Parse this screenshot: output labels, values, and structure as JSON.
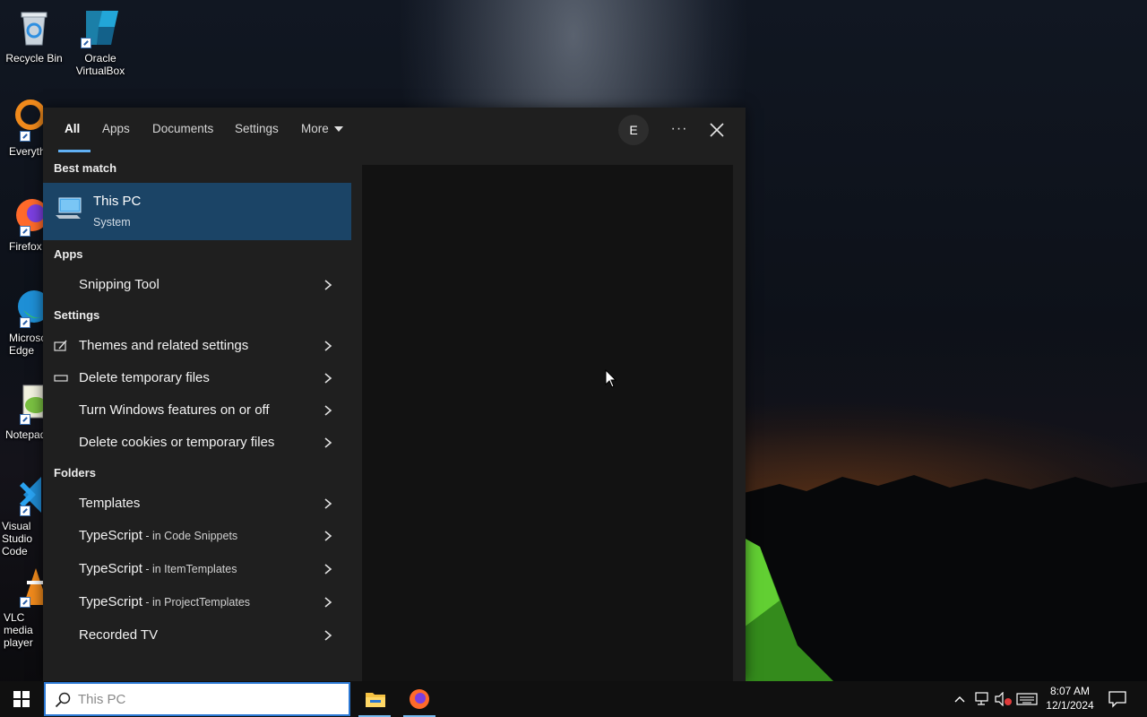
{
  "desktop": {
    "icons": [
      {
        "label": "Recycle Bin"
      },
      {
        "label": "Oracle VirtualBox"
      },
      {
        "label": "Everything"
      },
      {
        "label": "Firefox"
      },
      {
        "label": "Microsoft Edge"
      },
      {
        "label": "Notepad++"
      },
      {
        "label": "Visual Studio Code"
      },
      {
        "label": "VLC media player"
      }
    ]
  },
  "search": {
    "tabs": [
      {
        "label": "All"
      },
      {
        "label": "Apps"
      },
      {
        "label": "Documents"
      },
      {
        "label": "Settings"
      },
      {
        "label": "More"
      }
    ],
    "avatar_initial": "E",
    "more_options": "···",
    "sections": {
      "best_match": "Best match",
      "apps": "Apps",
      "settings": "Settings",
      "folders": "Folders"
    },
    "best_match": {
      "title": "This PC",
      "subtitle": "System"
    },
    "apps": [
      {
        "label": "Snipping Tool"
      }
    ],
    "settings": [
      {
        "label": "Themes and related settings"
      },
      {
        "label": "Delete temporary files"
      },
      {
        "label": "Turn Windows features on or off"
      },
      {
        "label": "Delete cookies or temporary files"
      }
    ],
    "folders": [
      {
        "label": "Templates",
        "sub": ""
      },
      {
        "label": "TypeScript",
        "sub": " - in Code Snippets"
      },
      {
        "label": "TypeScript",
        "sub": " - in ItemTemplates"
      },
      {
        "label": "TypeScript",
        "sub": " - in ProjectTemplates"
      },
      {
        "label": "Recorded TV",
        "sub": ""
      }
    ],
    "input": {
      "value": "",
      "placeholder": "This PC"
    }
  },
  "taskbar": {
    "clock": {
      "time": "8:07 AM",
      "date": "12/1/2024"
    }
  },
  "colors": {
    "accent": "#2b78d4",
    "selection": "#1b4466",
    "panel": "#1f1f1f",
    "tab_underline": "#60b0f4"
  }
}
